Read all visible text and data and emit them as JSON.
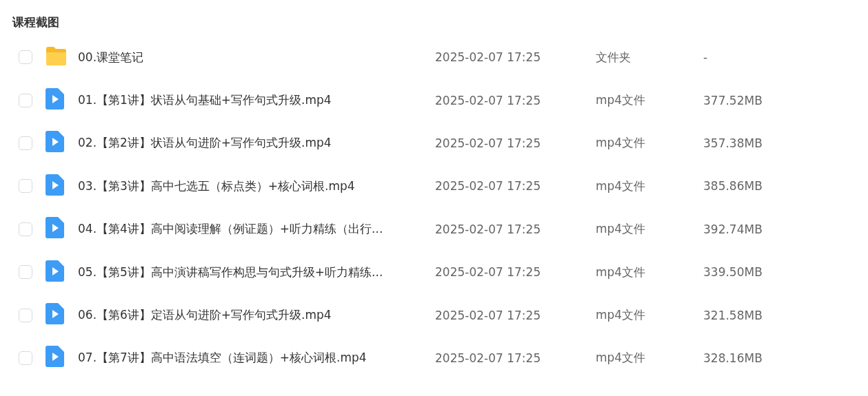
{
  "title": "课程截图",
  "files": [
    {
      "kind": "folder",
      "name": "00.课堂笔记",
      "date": "2025-02-07 17:25",
      "type": "文件夹",
      "size": "-",
      "checked": false
    },
    {
      "kind": "video",
      "name": "01.【第1讲】状语从句基础+写作句式升级.mp4",
      "date": "2025-02-07 17:25",
      "type": "mp4文件",
      "size": "377.52MB",
      "checked": false
    },
    {
      "kind": "video",
      "name": "02.【第2讲】状语从句进阶+写作句式升级.mp4",
      "date": "2025-02-07 17:25",
      "type": "mp4文件",
      "size": "357.38MB",
      "checked": false
    },
    {
      "kind": "video",
      "name": "03.【第3讲】高中七选五（标点类）+核心词根.mp4",
      "date": "2025-02-07 17:25",
      "type": "mp4文件",
      "size": "385.86MB",
      "checked": false
    },
    {
      "kind": "video",
      "name": "04.【第4讲】高中阅读理解（例证题）+听力精练（出行...",
      "date": "2025-02-07 17:25",
      "type": "mp4文件",
      "size": "392.74MB",
      "checked": false
    },
    {
      "kind": "video",
      "name": "05.【第5讲】高中演讲稿写作构思与句式升级+听力精练...",
      "date": "2025-02-07 17:25",
      "type": "mp4文件",
      "size": "339.50MB",
      "checked": false
    },
    {
      "kind": "video",
      "name": "06.【第6讲】定语从句进阶+写作句式升级.mp4",
      "date": "2025-02-07 17:25",
      "type": "mp4文件",
      "size": "321.58MB",
      "checked": false
    },
    {
      "kind": "video",
      "name": "07.【第7讲】高中语法填空（连词题）+核心词根.mp4",
      "date": "2025-02-07 17:25",
      "type": "mp4文件",
      "size": "328.16MB",
      "checked": false
    }
  ]
}
